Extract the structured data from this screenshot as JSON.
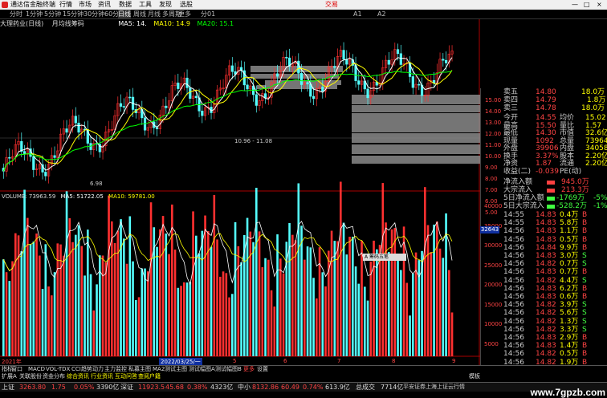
{
  "titlebar": {
    "app": "通达信金融终端",
    "menus": [
      "行情",
      "市场",
      "资讯",
      "数据",
      "工具",
      "发现",
      "选股"
    ],
    "exchange": "交易",
    "win_min": "—",
    "win_max": "□",
    "win_close": "×"
  },
  "periods": [
    "分时",
    "1分钟",
    "5分钟",
    "15分钟",
    "30分钟",
    "60分钟",
    "日线",
    "周线",
    "月线",
    "多周期",
    "更多"
  ],
  "active_period": "日线",
  "toolbar_right": [
    "分01",
    "A1",
    "A2"
  ],
  "kline_header": {
    "name": "大理药业(日线)",
    "chip": "月均线筹码",
    "ma5": "MA5: 14.",
    "ma10": "MA10: 14.9",
    "ma20": "MA20: 15.1",
    "colors": {
      "ma5": "#ffffff",
      "ma10": "#ffff00",
      "ma20": "#00ff00"
    }
  },
  "price_labels": {
    "low": "6.98",
    "range": "10.96 - 11.08"
  },
  "price_axis": [
    "15.00",
    "14.00",
    "13.00",
    "12.00",
    "11.00",
    "10.00",
    "9.00",
    "8.00",
    "7.00",
    "6.00",
    "5.00"
  ],
  "volume_header": {
    "title": "VOLUME: 73963.59",
    "ma5": "MA5: 51722.05",
    "ma10": "MA10: 59781.00"
  },
  "volume_axis": [
    "40000",
    "35000",
    "30000",
    "25000",
    "20000",
    "15000",
    "10000",
    "5000"
  ],
  "volume_cursor": "32643",
  "date_cursor": "2022/03/25/一",
  "year_label": "2021年",
  "x_labels": [
    "5",
    "6",
    "7",
    "8",
    "9"
  ],
  "tooltip": "A 筹码五笔",
  "order_book": [
    {
      "label": "卖五",
      "price": "14.80",
      "vol": "18.0万"
    },
    {
      "label": "卖四",
      "price": "14.79",
      "vol": "1.8万"
    },
    {
      "label": "卖三",
      "price": "14.78",
      "vol": "18.0万"
    }
  ],
  "quote_rows": [
    {
      "l1": "今开",
      "v1": "14.55",
      "l2": "均价",
      "v2": "15.02"
    },
    {
      "l1": "最高",
      "v1": "15.50",
      "l2": "量比",
      "v2": "1.57"
    },
    {
      "l1": "最低",
      "v1": "14.30",
      "l2": "市值",
      "v2": "32.6亿"
    },
    {
      "l1": "现量",
      "v1": "1092",
      "l2": "总量",
      "v2": "73964"
    },
    {
      "l1": "外盘",
      "v1": "39906",
      "l2": "内盘",
      "v2": "34058"
    },
    {
      "l1": "换手",
      "v1": "3.37%",
      "l2": "股本",
      "v2": "2.20亿"
    },
    {
      "l1": "净资",
      "v1": "1.87",
      "l2": "流通",
      "v2": "2.20亿"
    },
    {
      "l1": "收益(二)",
      "v1": "-0.039",
      "l2": "PE(动)",
      "v2": ""
    }
  ],
  "flows": [
    {
      "label": "净流入额",
      "value": "945.0万",
      "color": "#ff4040"
    },
    {
      "label": "大宗流入",
      "value": "213.3万",
      "color": "#ff4040"
    },
    {
      "label": "5日净流入额",
      "value": "-1769万",
      "color": "#40ff40",
      "pct": "-5%"
    },
    {
      "label": "5日大宗流入",
      "value": "-528.2万",
      "color": "#40ff40",
      "pct": "-1%"
    }
  ],
  "ticks": [
    {
      "t": "14:55",
      "p": "14.83",
      "v": "0.4万",
      "d": "B"
    },
    {
      "t": "14:55",
      "p": "14.83",
      "v": "5.8万",
      "d": "B"
    },
    {
      "t": "14:56",
      "p": "14.83",
      "v": "1.1万",
      "d": "B"
    },
    {
      "t": "14:56",
      "p": "14.83",
      "v": "0.5万",
      "d": "B"
    },
    {
      "t": "14:56",
      "p": "14.84",
      "v": "9.9万",
      "d": "B"
    },
    {
      "t": "14:56",
      "p": "14.83",
      "v": "3.0万",
      "d": "S"
    },
    {
      "t": "14:56",
      "p": "14.82",
      "v": "0.7万",
      "d": "S"
    },
    {
      "t": "14:56",
      "p": "14.83",
      "v": "0.7万",
      "d": "B"
    },
    {
      "t": "14:56",
      "p": "14.82",
      "v": "4.4万",
      "d": "S"
    },
    {
      "t": "14:56",
      "p": "14.83",
      "v": "6.2万",
      "d": "B"
    },
    {
      "t": "14:56",
      "p": "14.83",
      "v": "0.6万",
      "d": "B"
    },
    {
      "t": "14:56",
      "p": "14.82",
      "v": "3.9万",
      "d": "S"
    },
    {
      "t": "14:56",
      "p": "14.82",
      "v": "5.6万",
      "d": "S"
    },
    {
      "t": "14:56",
      "p": "14.82",
      "v": "1.3万",
      "d": "S"
    },
    {
      "t": "14:56",
      "p": "14.82",
      "v": "3.3万",
      "d": "S"
    },
    {
      "t": "14:56",
      "p": "14.83",
      "v": "2.9万",
      "d": "B"
    },
    {
      "t": "14:56",
      "p": "14.83",
      "v": "1.4万",
      "d": "B"
    },
    {
      "t": "14:56",
      "p": "14.82",
      "v": "0.5万",
      "d": "B"
    },
    {
      "t": "14:56",
      "p": "14.82",
      "v": "1.9万",
      "d": "B"
    },
    {
      "t": "14:56",
      "p": "14.82",
      "v": "1.1万",
      "d": "B"
    }
  ],
  "ind_tabs": [
    "指标",
    "窗口",
    "MACD",
    "VOL-TDX",
    "CCI",
    "趋势动力",
    "主力监控",
    "私募主图",
    "MA2",
    "测试主图",
    "测试幅图A",
    "测试幅图B",
    "更多",
    "设置"
  ],
  "ext_tabs": [
    "扩展A",
    "关联股份",
    "资金分布",
    "综合资讯",
    "行业资讯",
    "互动问答",
    "查阅户籍"
  ],
  "ext_right": "模板",
  "status": [
    {
      "name": "上证",
      "value": "3263.80",
      "chg": "1.75",
      "pct": "0.05%",
      "amt": "3390亿"
    },
    {
      "name": "深证",
      "value": "11923.5",
      "chg": "45.68",
      "pct": "0.38%",
      "amt": "4323亿"
    },
    {
      "name": "中小",
      "value": "8132.86",
      "chg": "60.49",
      "pct": "0.74%",
      "amt": "613.9亿"
    }
  ],
  "status_extra": [
    "总成交",
    "7714亿",
    "平安证券上海上证云行情"
  ],
  "watermark": "www.7gpzb.com"
}
